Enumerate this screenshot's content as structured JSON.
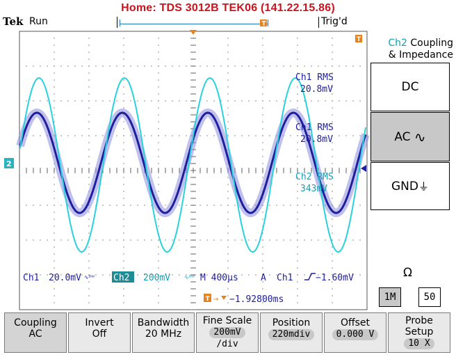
{
  "header": {
    "title": "Home:  TDS 3012B  TEK06  (141.22.15.86)",
    "brand": "Tek",
    "acq_state": "Run",
    "trigger_state": "Trig'd"
  },
  "waveform_labels": {
    "ch1_rms_a": "Ch1 RMS",
    "ch1_rms_a_value": "20.8mV",
    "ch1_rms_b": "Ch1 RMS",
    "ch1_rms_b_value": "20.8mV",
    "ch2_rms": "Ch2 RMS",
    "ch2_rms_value": "343mV",
    "ch2_marker": "2"
  },
  "status": {
    "ch1_label": "Ch1",
    "ch1_scale": "20.0mV",
    "ch2_label": "Ch2",
    "ch2_scale": "200mV",
    "timebase": "M 400µs",
    "trig_mode": "A",
    "trig_source": "Ch1",
    "trig_level": "−1.60mV",
    "trig_offset": "−1.92800ms"
  },
  "side_menu": {
    "title_ch": "Ch2",
    "title_rest": "Coupling",
    "title_line2": "& Impedance",
    "options": [
      {
        "label": "DC"
      },
      {
        "label": "AC"
      },
      {
        "label": "GND"
      }
    ],
    "selected": "AC",
    "impedance_symbol": "Ω",
    "impedance_options": [
      "1M",
      "50"
    ],
    "impedance_selected": "1M"
  },
  "bottom_menu": [
    {
      "label": "Coupling",
      "value": "AC"
    },
    {
      "label": "Invert",
      "value": "Off"
    },
    {
      "label": "Bandwidth",
      "value": "20 MHz"
    },
    {
      "label": "Fine Scale",
      "value": "200mV",
      "value2": "/div"
    },
    {
      "label": "Position",
      "value": "220mdiv"
    },
    {
      "label": "Offset",
      "value": "0.000 V"
    },
    {
      "label": "Probe",
      "label2": "Setup",
      "value": "10 X"
    }
  ],
  "colors": {
    "title": "#c8141e",
    "ch1": "#1e1e9e",
    "ch2": "#28d2dc",
    "ch2_text": "#14a0b4",
    "grid": "#5a5a5a"
  }
}
